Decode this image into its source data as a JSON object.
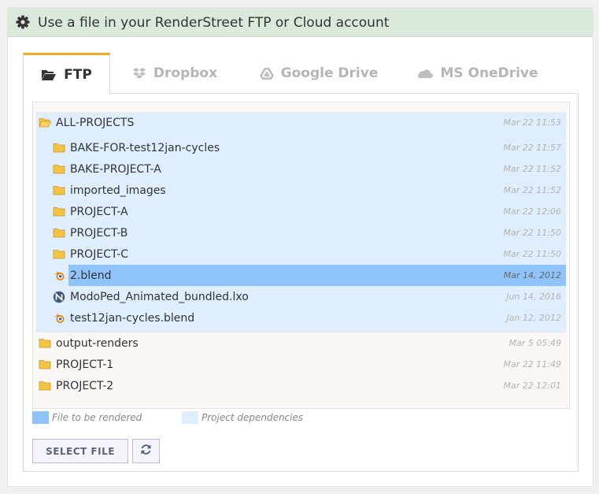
{
  "header": {
    "title": "Use a file in your RenderStreet FTP or Cloud account",
    "icon": "gear-icon"
  },
  "tabs": [
    {
      "label": "FTP",
      "icon": "folder-open-icon",
      "active": true
    },
    {
      "label": "Dropbox",
      "icon": "dropbox-icon",
      "active": false
    },
    {
      "label": "Google Drive",
      "icon": "google-drive-icon",
      "active": false
    },
    {
      "label": "MS OneDrive",
      "icon": "onedrive-icon",
      "active": false
    }
  ],
  "tree": {
    "root": {
      "name": "ALL-PROJECTS",
      "date": "Mar 22 11:53",
      "icon": "folder-open-icon"
    },
    "children": [
      {
        "name": "BAKE-FOR-test12jan-cycles",
        "date": "Mar 22 11:57",
        "icon": "folder-icon"
      },
      {
        "name": "BAKE-PROJECT-A",
        "date": "Mar 22 11:52",
        "icon": "folder-icon"
      },
      {
        "name": "imported_images",
        "date": "Mar 22 11:52",
        "icon": "folder-icon"
      },
      {
        "name": "PROJECT-A",
        "date": "Mar 22 12:06",
        "icon": "folder-icon"
      },
      {
        "name": "PROJECT-B",
        "date": "Mar 22 11:50",
        "icon": "folder-icon"
      },
      {
        "name": "PROJECT-C",
        "date": "Mar 22 11:50",
        "icon": "folder-icon"
      },
      {
        "name": "2.blend",
        "date": "Mar 14, 2012",
        "icon": "blender-icon",
        "selected": true
      },
      {
        "name": "ModoPed_Animated_bundled.lxo",
        "date": "Jun 14, 2016",
        "icon": "modo-icon"
      },
      {
        "name": "test12jan-cycles.blend",
        "date": "Jan 12, 2012",
        "icon": "blender-icon"
      }
    ],
    "siblings": [
      {
        "name": "output-renders",
        "date": "Mar 5 05:49",
        "icon": "folder-icon"
      },
      {
        "name": "PROJECT-1",
        "date": "Mar 22 11:49",
        "icon": "folder-icon"
      },
      {
        "name": "PROJECT-2",
        "date": "Mar 22 12:01",
        "icon": "folder-icon"
      }
    ]
  },
  "legend": {
    "render_label": "File to be rendered",
    "deps_label": "Project dependencies",
    "render_color": "#8fc4fb",
    "deps_color": "#dfeefc"
  },
  "buttons": {
    "select_label": "SELECT FILE",
    "refresh_icon": "refresh-icon"
  },
  "colors": {
    "header_bg": "#dbe9dc",
    "tab_accent": "#f0ad25",
    "folder": "#f5c342"
  }
}
